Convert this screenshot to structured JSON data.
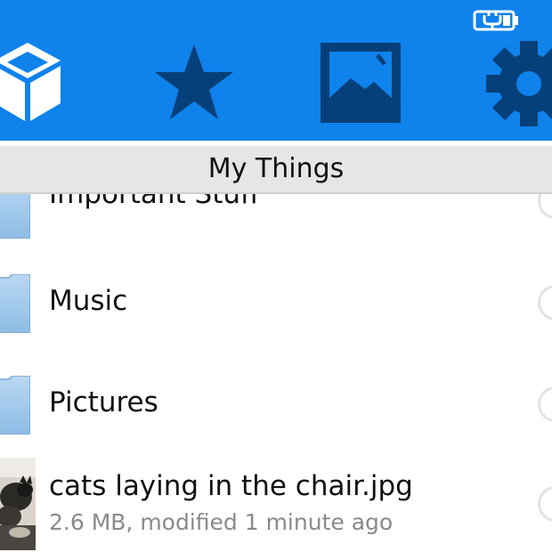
{
  "header": {
    "tabs": [
      {
        "name": "files",
        "icon": "box-icon"
      },
      {
        "name": "favorites",
        "icon": "star-icon"
      },
      {
        "name": "photos",
        "icon": "photo-icon"
      },
      {
        "name": "settings",
        "icon": "gear-icon"
      }
    ],
    "status_icon": "battery-charging-icon",
    "colors": {
      "appbar": "#0f82ec",
      "icon_dark": "#06407a",
      "icon_light": "#ffffff"
    }
  },
  "page": {
    "title": "My Things"
  },
  "list": {
    "items": [
      {
        "type": "folder",
        "label": "Important Stuff"
      },
      {
        "type": "folder",
        "label": "Music"
      },
      {
        "type": "folder",
        "label": "Pictures"
      },
      {
        "type": "file",
        "label": "cats laying in the chair.jpg",
        "meta": "2.6 MB, modified 1 minute ago"
      }
    ]
  }
}
